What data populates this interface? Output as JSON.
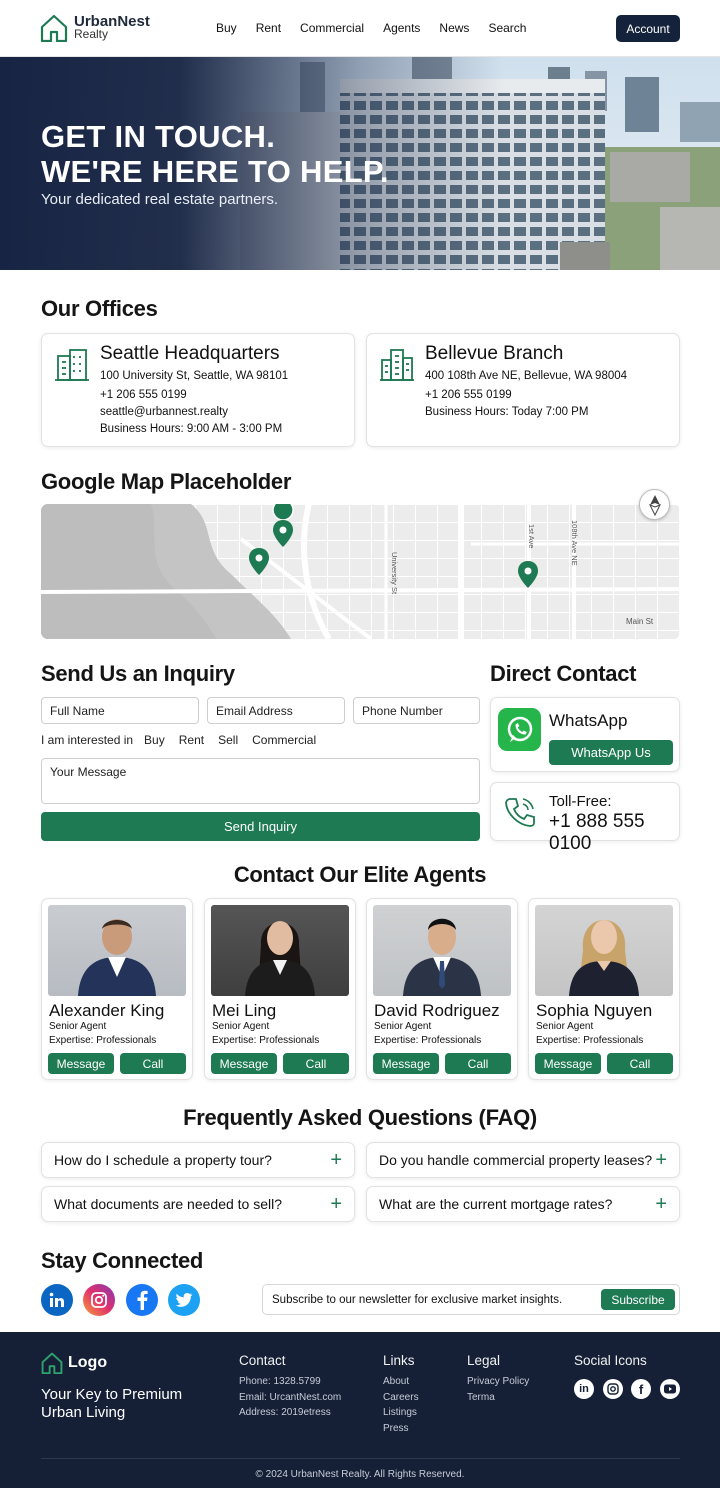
{
  "brand": {
    "name": "UrbanNest",
    "sub": "Realty"
  },
  "nav": [
    "Buy",
    "Rent",
    "Commercial",
    "Agents",
    "News",
    "Search"
  ],
  "account_label": "Account",
  "hero": {
    "line1": "GET IN TOUCH.",
    "line2": "WE'RE HERE TO HELP.",
    "subtitle": "Your dedicated real estate partners."
  },
  "offices": {
    "title": "Our Offices",
    "items": [
      {
        "name": "Seattle Headquarters",
        "address": "100 University St, Seattle, WA 98101",
        "phone": "+1 206 555 0199",
        "email": "seattle@urbannest.realty",
        "hours": "Business Hours: 9:00 AM - 3:00 PM"
      },
      {
        "name": "Bellevue Branch",
        "address": "400 108th Ave NE, Bellevue, WA 98004",
        "phone": "+1 206 555 0199",
        "hours": "Business Hours: Today 7:00 PM"
      }
    ]
  },
  "map": {
    "title": "Google Map Placeholder",
    "labels": [
      "1st Ave",
      "108th Ave NE",
      "University St",
      "Main St"
    ]
  },
  "inquiry": {
    "title": "Send Us an Inquiry",
    "full_name": "Full Name",
    "email": "Email Address",
    "phone": "Phone Number",
    "interest_label": "I am interested in",
    "interests": [
      "Buy",
      "Rent",
      "Sell",
      "Commercial"
    ],
    "message": "Your Message",
    "submit": "Send Inquiry"
  },
  "direct": {
    "title": "Direct Contact",
    "whatsapp_label": "WhatsApp",
    "whatsapp_button": "WhatsApp Us",
    "tollfree_label": "Toll-Free:",
    "tollfree_number": "+1 888 555 0100"
  },
  "agents": {
    "title": "Contact Our Elite Agents",
    "message_label": "Message",
    "call_label": "Call",
    "items": [
      {
        "name": "Alexander King",
        "role": "Senior Agent",
        "expertise": "Expertise: Professionals"
      },
      {
        "name": "Mei Ling",
        "role": "Senior Agent",
        "expertise": "Expertise: Professionals"
      },
      {
        "name": "David Rodriguez",
        "role": "Senior Agent",
        "expertise": "Expertise: Professionals"
      },
      {
        "name": "Sophia Nguyen",
        "role": "Senior Agent",
        "expertise": "Expertise: Professionals"
      }
    ]
  },
  "faq": {
    "title": "Frequently Asked Questions (FAQ)",
    "items": [
      "How do I schedule a property tour?",
      "Do you handle commercial property leases?",
      "What documents are needed to sell?",
      "What are the current mortgage rates?"
    ]
  },
  "connected": {
    "title": "Stay Connected",
    "icons": [
      "linkedin-icon",
      "instagram-icon",
      "facebook-icon",
      "twitter-icon"
    ],
    "newsletter_text": "Subscribe to our newsletter for exclusive market insights.",
    "subscribe": "Subscribe"
  },
  "footer": {
    "logo": "Logo",
    "tagline1": "Your Key to Premium",
    "tagline2": "Urban Living",
    "contact_title": "Contact",
    "contact": [
      "Phone: 1328.5799",
      "Email: UrcantNest.com",
      "Address: 2019etress"
    ],
    "links_title": "Links",
    "links": [
      "About",
      "Careers",
      "Listings",
      "Press"
    ],
    "legal_title": "Legal",
    "legal": [
      "Privacy Policy",
      "Terma"
    ],
    "social_title": "Social Icons",
    "copyright": "© 2024 UrbanNest Realty. All Rights Reserved."
  },
  "colors": {
    "navy": "#15223b",
    "green": "#1e7a52",
    "footer": "#152036"
  }
}
